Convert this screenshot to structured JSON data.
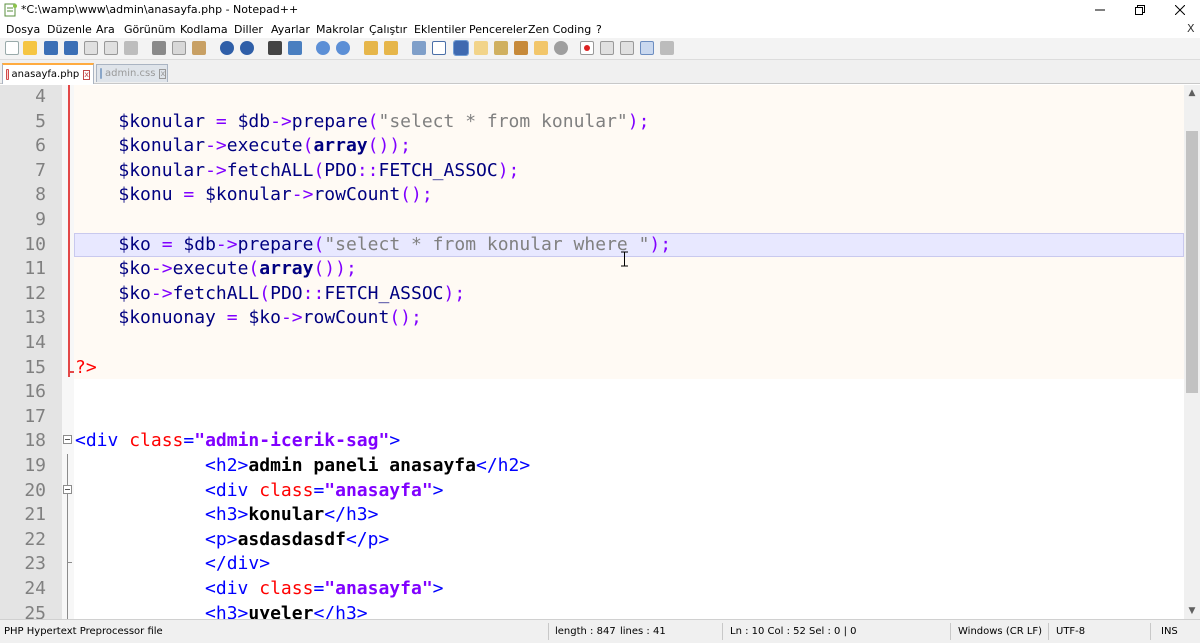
{
  "window": {
    "title": "*C:\\wamp\\www\\admin\\anasayfa.php - Notepad++",
    "minimize_glyph": "—",
    "maximize_glyph": "❐",
    "close_glyph": "✕"
  },
  "menu": {
    "items": [
      "Dosya",
      "Düzenle",
      "Ara",
      "Görünüm",
      "Kodlama",
      "Diller",
      "Ayarlar",
      "Makrolar",
      "Çalıştır",
      "Eklentiler",
      "Pencereler",
      "Zen Coding",
      "?"
    ],
    "close_glyph": "X"
  },
  "toolbar": {
    "icons": [
      "new-file-icon",
      "open-file-icon",
      "save-icon",
      "save-all-icon",
      "close-icon",
      "close-all-icon",
      "print-icon",
      "cut-icon",
      "copy-icon",
      "paste-icon",
      "undo-icon",
      "redo-icon",
      "find-icon",
      "replace-icon",
      "zoom-in-icon",
      "zoom-out-icon",
      "sync-vertical-icon",
      "sync-horizontal-icon",
      "word-wrap-icon",
      "show-all-chars-icon",
      "indent-guide-icon",
      "user-language-icon",
      "doc-map-icon",
      "function-list-icon",
      "folder-workspace-icon",
      "monitoring-icon",
      "record-macro-icon",
      "stop-macro-icon",
      "play-macro-icon",
      "run-macro-multiple-icon",
      "save-macro-icon"
    ]
  },
  "tabs": [
    {
      "label": "anasayfa.php",
      "active": true
    },
    {
      "label": "admin.css",
      "active": false
    }
  ],
  "editor": {
    "lines": [
      {
        "n": "4",
        "tokens": []
      },
      {
        "n": "5",
        "tokens": [
          [
            "    ",
            ""
          ],
          [
            "$konular",
            "var"
          ],
          [
            " ",
            ""
          ],
          [
            "=",
            "op"
          ],
          [
            " ",
            ""
          ],
          [
            "$db",
            "var"
          ],
          [
            "->",
            "op"
          ],
          [
            "prepare",
            "fn"
          ],
          [
            "(",
            "op"
          ],
          [
            "\"select * from konular\"",
            "str"
          ],
          [
            ");",
            "op"
          ]
        ]
      },
      {
        "n": "6",
        "tokens": [
          [
            "    ",
            ""
          ],
          [
            "$konular",
            "var"
          ],
          [
            "->",
            "op"
          ],
          [
            "execute",
            "fn"
          ],
          [
            "(",
            "op"
          ],
          [
            "array",
            "kw"
          ],
          [
            "());",
            "op"
          ]
        ]
      },
      {
        "n": "7",
        "tokens": [
          [
            "    ",
            ""
          ],
          [
            "$konular",
            "var"
          ],
          [
            "->",
            "op"
          ],
          [
            "fetchALL",
            "fn"
          ],
          [
            "(",
            "op"
          ],
          [
            "PDO",
            "fn"
          ],
          [
            "::",
            "op"
          ],
          [
            "FETCH_ASSOC",
            "fn"
          ],
          [
            ");",
            "op"
          ]
        ]
      },
      {
        "n": "8",
        "tokens": [
          [
            "    ",
            ""
          ],
          [
            "$konu",
            "var"
          ],
          [
            " ",
            ""
          ],
          [
            "=",
            "op"
          ],
          [
            " ",
            ""
          ],
          [
            "$konular",
            "var"
          ],
          [
            "->",
            "op"
          ],
          [
            "rowCount",
            "fn"
          ],
          [
            "();",
            "op"
          ]
        ]
      },
      {
        "n": "9",
        "tokens": []
      },
      {
        "n": "10",
        "tokens": [
          [
            "    ",
            ""
          ],
          [
            "$ko",
            "var"
          ],
          [
            " ",
            ""
          ],
          [
            "=",
            "op"
          ],
          [
            " ",
            ""
          ],
          [
            "$db",
            "var"
          ],
          [
            "->",
            "op"
          ],
          [
            "prepare",
            "fn"
          ],
          [
            "(",
            "op"
          ],
          [
            "\"select * from konular where \"",
            "str"
          ],
          [
            ");",
            "op"
          ]
        ]
      },
      {
        "n": "11",
        "tokens": [
          [
            "    ",
            ""
          ],
          [
            "$ko",
            "var"
          ],
          [
            "->",
            "op"
          ],
          [
            "execute",
            "fn"
          ],
          [
            "(",
            "op"
          ],
          [
            "array",
            "kw"
          ],
          [
            "());",
            "op"
          ]
        ]
      },
      {
        "n": "12",
        "tokens": [
          [
            "    ",
            ""
          ],
          [
            "$ko",
            "var"
          ],
          [
            "->",
            "op"
          ],
          [
            "fetchALL",
            "fn"
          ],
          [
            "(",
            "op"
          ],
          [
            "PDO",
            "fn"
          ],
          [
            "::",
            "op"
          ],
          [
            "FETCH_ASSOC",
            "fn"
          ],
          [
            ");",
            "op"
          ]
        ]
      },
      {
        "n": "13",
        "tokens": [
          [
            "    ",
            ""
          ],
          [
            "$konuonay",
            "var"
          ],
          [
            " ",
            ""
          ],
          [
            "=",
            "op"
          ],
          [
            " ",
            ""
          ],
          [
            "$ko",
            "var"
          ],
          [
            "->",
            "op"
          ],
          [
            "rowCount",
            "fn"
          ],
          [
            "();",
            "op"
          ]
        ]
      },
      {
        "n": "14",
        "tokens": []
      },
      {
        "n": "15",
        "tokens": [
          [
            "?>",
            "php"
          ]
        ]
      },
      {
        "n": "16",
        "tokens": []
      },
      {
        "n": "17",
        "tokens": []
      },
      {
        "n": "18",
        "tokens": [
          [
            "<div",
            "tag"
          ],
          [
            " ",
            ""
          ],
          [
            "class",
            "attr"
          ],
          [
            "=",
            "tag"
          ],
          [
            "\"admin-icerik-sag\"",
            "aval"
          ],
          [
            ">",
            "tag"
          ]
        ]
      },
      {
        "n": "19",
        "tokens": [
          [
            "            ",
            ""
          ],
          [
            "<h2>",
            "tag"
          ],
          [
            "admin paneli anasayfa",
            "text"
          ],
          [
            "</h2>",
            "tag"
          ]
        ]
      },
      {
        "n": "20",
        "tokens": [
          [
            "            ",
            ""
          ],
          [
            "<div",
            "tag"
          ],
          [
            " ",
            ""
          ],
          [
            "class",
            "attr"
          ],
          [
            "=",
            "tag"
          ],
          [
            "\"anasayfa\"",
            "aval"
          ],
          [
            ">",
            "tag"
          ]
        ]
      },
      {
        "n": "21",
        "tokens": [
          [
            "            ",
            ""
          ],
          [
            "<h3>",
            "tag"
          ],
          [
            "konular",
            "text"
          ],
          [
            "</h3>",
            "tag"
          ]
        ]
      },
      {
        "n": "22",
        "tokens": [
          [
            "            ",
            ""
          ],
          [
            "<p>",
            "tag"
          ],
          [
            "asdasdasdf",
            "text"
          ],
          [
            "</p>",
            "tag"
          ]
        ]
      },
      {
        "n": "23",
        "tokens": [
          [
            "            ",
            ""
          ],
          [
            "</div>",
            "tag"
          ]
        ]
      },
      {
        "n": "24",
        "tokens": [
          [
            "            ",
            ""
          ],
          [
            "<div",
            "tag"
          ],
          [
            " ",
            ""
          ],
          [
            "class",
            "attr"
          ],
          [
            "=",
            "tag"
          ],
          [
            "\"anasayfa\"",
            "aval"
          ],
          [
            ">",
            "tag"
          ]
        ]
      },
      {
        "n": "25",
        "tokens": [
          [
            "            ",
            ""
          ],
          [
            "<h3>",
            "tag"
          ],
          [
            "uyeler",
            "text"
          ],
          [
            "</h3>",
            "tag"
          ]
        ]
      }
    ]
  },
  "statusbar": {
    "file_type": "PHP Hypertext Preprocessor file",
    "length": "length : 847",
    "lines": "lines : 41",
    "position": "Ln : 10    Col : 52    Sel : 0 | 0",
    "eol": "Windows (CR LF)",
    "encoding": "UTF-8",
    "mode": "INS"
  }
}
